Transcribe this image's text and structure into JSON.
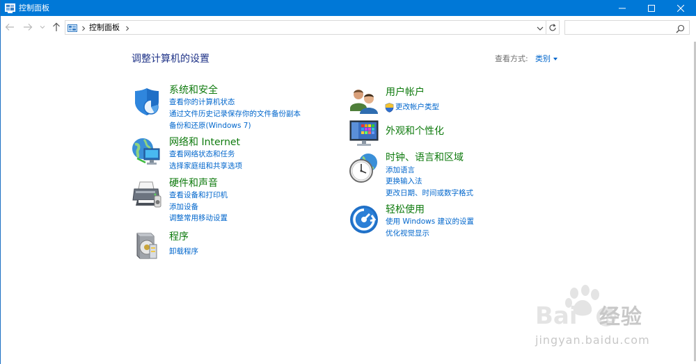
{
  "window": {
    "title": "控制面板",
    "icon": "control-panel-icon",
    "accent": "#0078d7"
  },
  "nav": {
    "breadcrumb": "控制面板",
    "search_placeholder": ""
  },
  "page": {
    "title": "调整计算机的设置",
    "view_by_label": "查看方式:",
    "view_by_value": "类别"
  },
  "categories": [
    {
      "title": "系统和安全",
      "icon": "shield-icon",
      "links": [
        "查看你的计算机状态",
        "通过文件历史记录保存你的文件备份副本",
        "备份和还原(Windows 7)"
      ]
    },
    {
      "title": "网络和 Internet",
      "icon": "network-globe-icon",
      "links": [
        "查看网络状态和任务",
        "选择家庭组和共享选项"
      ]
    },
    {
      "title": "硬件和声音",
      "icon": "printer-icon",
      "links": [
        "查看设备和打印机",
        "添加设备",
        "调整常用移动设置"
      ]
    },
    {
      "title": "程序",
      "icon": "programs-icon",
      "links": [
        "卸载程序"
      ]
    },
    {
      "title": "用户帐户",
      "icon": "users-icon",
      "links": [
        "更改帐户类型"
      ]
    },
    {
      "title": "外观和个性化",
      "icon": "monitor-icon",
      "links": []
    },
    {
      "title": "时钟、语言和区域",
      "icon": "clock-globe-icon",
      "links": [
        "添加语言",
        "更换输入法",
        "更改日期、时间或数字格式"
      ]
    },
    {
      "title": "轻松使用",
      "icon": "ease-of-access-icon",
      "links": [
        "使用 Windows 建议的设置",
        "优化视觉显示"
      ]
    }
  ],
  "watermark": {
    "brand": "经验",
    "url": "jingyan.baidu.com"
  },
  "colors": {
    "category_title": "#0e7a0d",
    "link": "#0066cc",
    "page_title": "#1e3287"
  }
}
